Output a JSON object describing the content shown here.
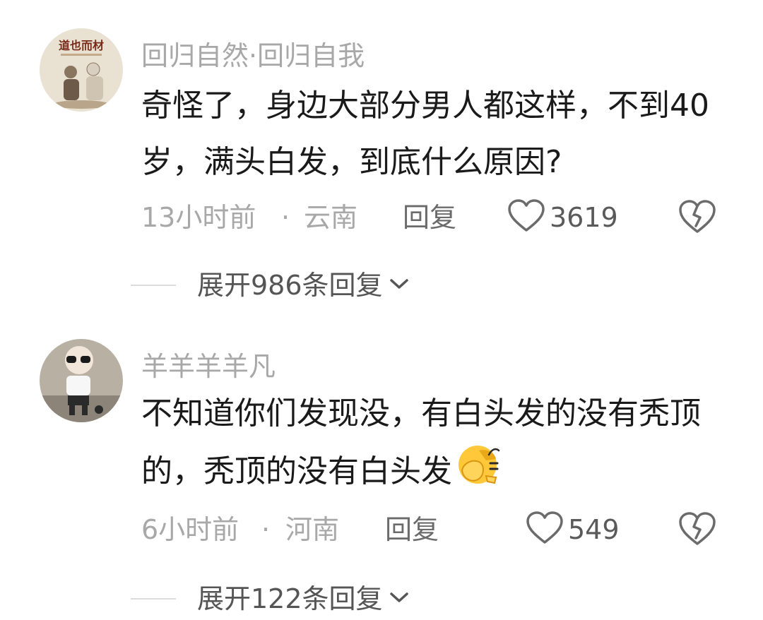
{
  "comments": [
    {
      "username": "回归自然·回归自我",
      "avatar_text": "道也而材",
      "text": "奇怪了，身边大部分男人都这样，不到40岁，满头白发，到底什么原因?",
      "time": "13小时前",
      "separator": "·",
      "location": "云南",
      "reply_label": "回复",
      "likes": "3619",
      "expand_label": "展开986条回复"
    },
    {
      "username": "羊羊羊羊凡",
      "text": "不知道你们发现没，有白头发的没有秃顶的，秃顶的没有白头发",
      "emoji": "facepalm-emoji",
      "time": "6小时前",
      "separator": "·",
      "location": "河南",
      "reply_label": "回复",
      "likes": "549",
      "expand_label": "展开122条回复"
    }
  ],
  "icons": {
    "like": "heart-outline-icon",
    "dislike": "broken-heart-icon",
    "expand": "chevron-down-icon"
  },
  "colors": {
    "meta": "#a8a8a8",
    "body": "#1a1a1a",
    "icon": "#6b6b6b"
  }
}
